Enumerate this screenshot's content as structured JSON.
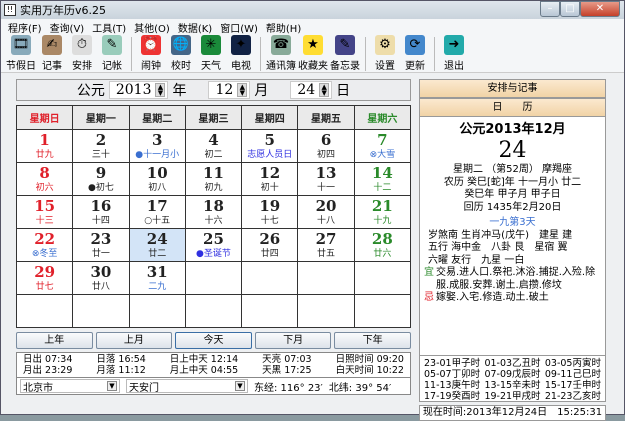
{
  "window": {
    "title": "实用万年历v6.25"
  },
  "menu": [
    "程序(F)",
    "查询(V)",
    "工具(T)",
    "其他(O)",
    "数据(K)",
    "窗口(W)",
    "帮助(H)"
  ],
  "toolbar": [
    {
      "label": "节假日",
      "icon": "holiday-icon",
      "color": "#8ab",
      "glyph": "🎞"
    },
    {
      "label": "记事",
      "icon": "notes-icon",
      "color": "#a86",
      "glyph": "✍"
    },
    {
      "label": "安排",
      "icon": "schedule-icon",
      "color": "#ddd",
      "glyph": "⏱"
    },
    {
      "label": "记帐",
      "icon": "accounts-icon",
      "color": "#9cb",
      "glyph": "✎"
    },
    {
      "sep": true
    },
    {
      "label": "闹钟",
      "icon": "alarm-clock-icon",
      "color": "#e33",
      "glyph": "⏰"
    },
    {
      "label": "校时",
      "icon": "time-sync-icon",
      "color": "#468",
      "glyph": "🌐"
    },
    {
      "label": "天气",
      "icon": "weather-icon",
      "color": "#1a8a3a",
      "glyph": "✳"
    },
    {
      "label": "电视",
      "icon": "tv-icon",
      "color": "#124",
      "glyph": "✦"
    },
    {
      "sep": true
    },
    {
      "label": "通讯簿",
      "icon": "address-book-icon",
      "color": "#8a9",
      "glyph": "☎"
    },
    {
      "label": "收藏夹",
      "icon": "favorites-icon",
      "color": "#fd3",
      "glyph": "★"
    },
    {
      "label": "备忘录",
      "icon": "memo-icon",
      "color": "#448",
      "glyph": "✎"
    },
    {
      "sep": true
    },
    {
      "label": "设置",
      "icon": "settings-icon",
      "color": "#eda",
      "glyph": "⚙"
    },
    {
      "label": "更新",
      "icon": "update-icon",
      "color": "#48c",
      "glyph": "⟳"
    },
    {
      "sep": true
    },
    {
      "label": "退出",
      "icon": "exit-icon",
      "color": "#2aa",
      "glyph": "➜"
    }
  ],
  "date_selector": {
    "prefix": "公元",
    "year": "2013",
    "year_unit": "年",
    "month": "12",
    "month_unit": "月",
    "day": "24",
    "day_unit": "日"
  },
  "weekdays": [
    {
      "label": "星期日",
      "c": "red"
    },
    {
      "label": "星期一",
      "c": "blk"
    },
    {
      "label": "星期二",
      "c": "blk"
    },
    {
      "label": "星期三",
      "c": "blk"
    },
    {
      "label": "星期四",
      "c": "blk"
    },
    {
      "label": "星期五",
      "c": "blk"
    },
    {
      "label": "星期六",
      "c": "green"
    }
  ],
  "calendar": [
    [
      {
        "n": "1",
        "s": "廿九",
        "c": "red",
        "sc": "red"
      },
      {
        "n": "2",
        "s": "三十"
      },
      {
        "n": "3",
        "s": "●十一月小",
        "sc": "blue"
      },
      {
        "n": "4",
        "s": "初二"
      },
      {
        "n": "5",
        "s": "志愿人员日",
        "sc": "vio"
      },
      {
        "n": "6",
        "s": "初四"
      },
      {
        "n": "7",
        "s": "⊗大雪",
        "c": "green",
        "sc": "blue"
      }
    ],
    [
      {
        "n": "8",
        "s": "初六",
        "c": "red",
        "sc": "red"
      },
      {
        "n": "9",
        "s": "●初七"
      },
      {
        "n": "10",
        "s": "初八"
      },
      {
        "n": "11",
        "s": "初九"
      },
      {
        "n": "12",
        "s": "初十"
      },
      {
        "n": "13",
        "s": "十一"
      },
      {
        "n": "14",
        "s": "十二",
        "c": "green",
        "sc": "green"
      }
    ],
    [
      {
        "n": "15",
        "s": "十三",
        "c": "red",
        "sc": "red"
      },
      {
        "n": "16",
        "s": "十四"
      },
      {
        "n": "17",
        "s": "○十五"
      },
      {
        "n": "18",
        "s": "十六"
      },
      {
        "n": "19",
        "s": "十七"
      },
      {
        "n": "20",
        "s": "十八"
      },
      {
        "n": "21",
        "s": "十九",
        "c": "green",
        "sc": "green"
      }
    ],
    [
      {
        "n": "22",
        "s": "⊗冬至",
        "c": "red",
        "sc": "blue"
      },
      {
        "n": "23",
        "s": "廿一"
      },
      {
        "n": "24",
        "s": "廿二",
        "today": true
      },
      {
        "n": "25",
        "s": "●圣诞节",
        "sc": "vio"
      },
      {
        "n": "26",
        "s": "廿四"
      },
      {
        "n": "27",
        "s": "廿五"
      },
      {
        "n": "28",
        "s": "廿六",
        "c": "green",
        "sc": "green"
      }
    ],
    [
      {
        "n": "29",
        "s": "廿七",
        "c": "red",
        "sc": "red"
      },
      {
        "n": "30",
        "s": "廿八"
      },
      {
        "n": "31",
        "s": "二九",
        "sc": "blue"
      },
      {},
      {},
      {},
      {}
    ],
    [
      {},
      {},
      {},
      {},
      {},
      {},
      {}
    ]
  ],
  "nav": {
    "prev_year": "上年",
    "prev_month": "上月",
    "today": "今天",
    "next_month": "下月",
    "next_year": "下年"
  },
  "sun": [
    [
      "日出 07:34",
      "日落 16:54",
      "日上中天 12:14",
      "天亮 07:03",
      "日照时间 09:20"
    ],
    [
      "月出 23:29",
      "月落 11:12",
      "月上中天 04:55",
      "天黑 17:25",
      "白天时间 10:22"
    ]
  ],
  "location": {
    "city": "北京市",
    "place": "天安门",
    "longitude": "东经: 116° 23′",
    "latitude": "北纬: 39° 54′"
  },
  "right": {
    "tab1": "安排与记事",
    "tab2": "日　　历",
    "ymd": "公元2013年12月",
    "day": "24",
    "lines": [
      "星期二 （第52周） 摩羯座",
      "农历 癸巳[蛇]年 十一月小 廿二",
      "癸巳年 甲子月 甲子日",
      "回历 1435年2月20日"
    ],
    "jiu": "一九第3天",
    "info": [
      "岁煞南 生肖冲马(戊午)　建星 建",
      "五行 海中金　八卦 艮　星宿 翼",
      "六曜 友行　九星 一白"
    ],
    "yi_label": "宜",
    "yi": "交易.进人口.祭祀.沐浴.捕捉.入殓.除服.成服.安葬.谢土.启攒.修坟",
    "ji_label": "忌",
    "ji": "嫁娶.入宅.修造.动土.破土",
    "hours": [
      [
        "23-01甲子时",
        "01-03乙丑时",
        "03-05丙寅时"
      ],
      [
        "05-07丁卯时",
        "07-09戊辰时",
        "09-11己巳时"
      ],
      [
        "11-13庚午时",
        "13-15辛未时",
        "15-17壬申时"
      ],
      [
        "17-19癸酉时",
        "19-21甲戌时",
        "21-23乙亥时"
      ]
    ],
    "now": "现在时间:2013年12月24日　15:25:31"
  }
}
